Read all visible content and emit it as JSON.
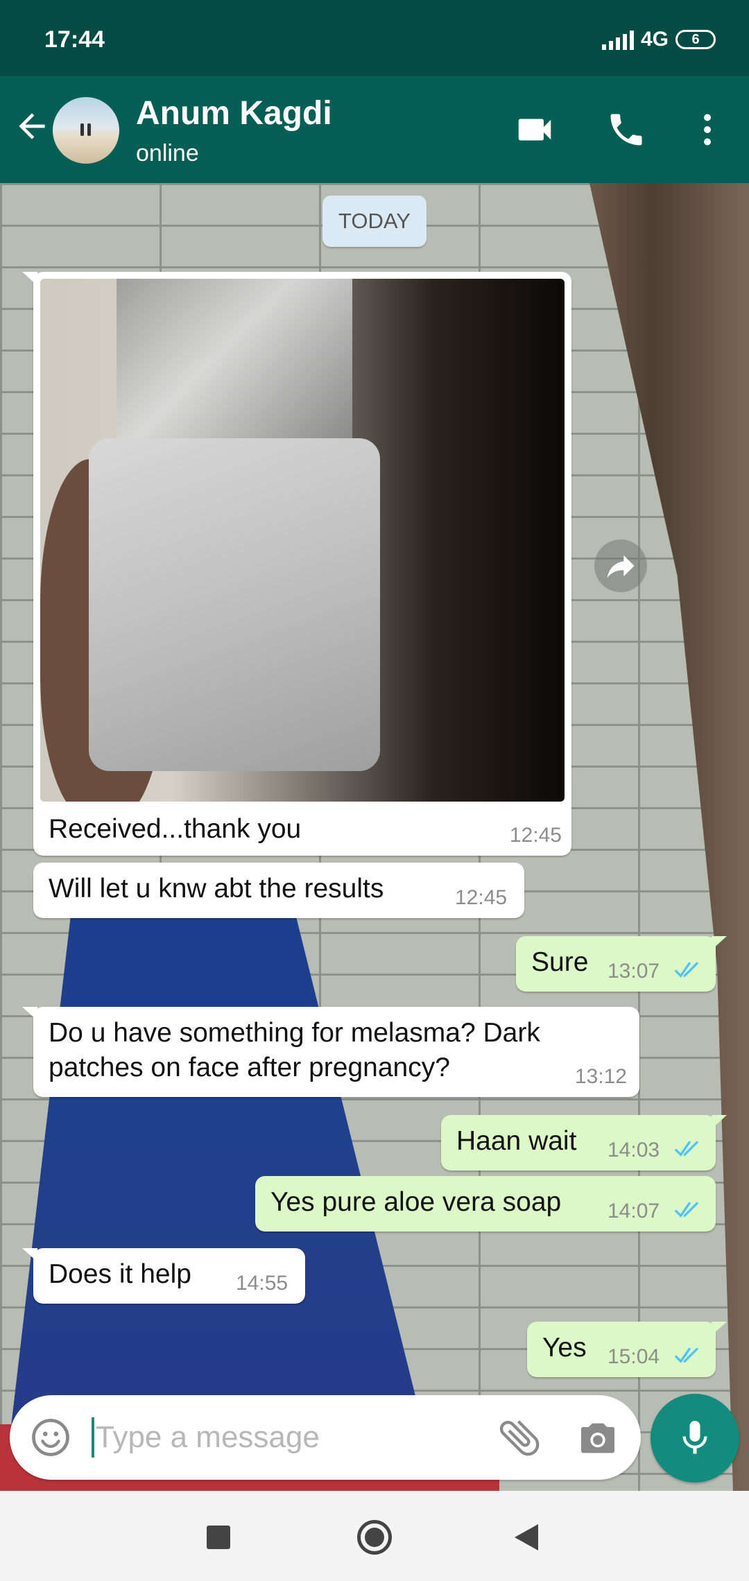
{
  "status_bar": {
    "time": "17:44",
    "network": "4G",
    "battery": "6"
  },
  "header": {
    "contact_name": "Anum Kagdi",
    "status": "online"
  },
  "date_chip": "TODAY",
  "messages": [
    {
      "direction": "in",
      "type": "image",
      "caption": "Received...thank you",
      "time": "12:45"
    },
    {
      "direction": "in",
      "text": "Will let u knw abt the results",
      "time": "12:45"
    },
    {
      "direction": "out",
      "text": "Sure",
      "time": "13:07",
      "read": true
    },
    {
      "direction": "in",
      "text_line1": "Do u have something for melasma? Dark",
      "text_line2": "patches on face after pregnancy?",
      "time": "13:12"
    },
    {
      "direction": "out",
      "text": "Haan wait",
      "time": "14:03",
      "read": true
    },
    {
      "direction": "out",
      "text": "Yes pure aloe vera soap",
      "time": "14:07",
      "read": true
    },
    {
      "direction": "in",
      "text": "Does it help",
      "time": "14:55"
    },
    {
      "direction": "out",
      "text": "Yes",
      "time": "15:04",
      "read": true
    }
  ],
  "input": {
    "placeholder": "Type a message",
    "value": ""
  },
  "icons": {
    "back": "arrow-left-icon",
    "video": "video-call-icon",
    "call": "phone-icon",
    "menu": "more-vert-icon",
    "forward": "forward-icon",
    "emoji": "emoji-icon",
    "attach": "paperclip-icon",
    "camera": "camera-icon",
    "mic": "mic-icon"
  },
  "colors": {
    "header": "#075e54",
    "status_bar": "#054d44",
    "outgoing_bubble": "#dcf8c6",
    "incoming_bubble": "#ffffff",
    "accent": "#128c7e",
    "read_ticks": "#4fc3f7"
  }
}
